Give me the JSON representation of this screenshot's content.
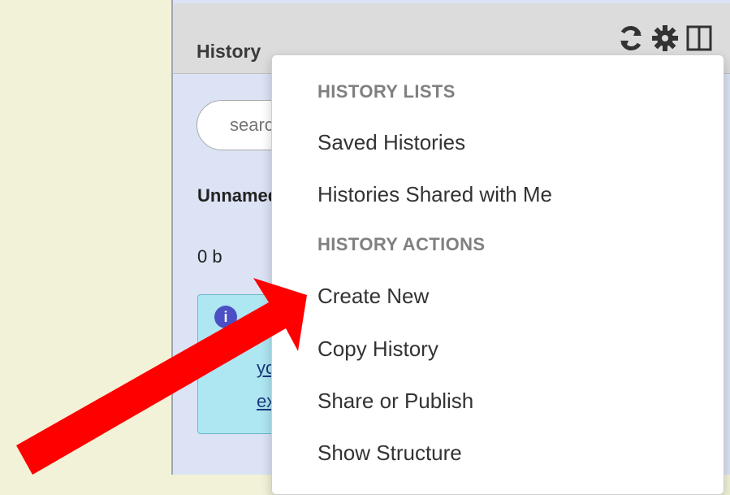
{
  "history_panel": {
    "title": "History",
    "search_placeholder": "search",
    "history_name": "Unnamed history",
    "history_size": "0 b",
    "info_link_line1": "you",
    "info_link_line2": "ex"
  },
  "header_icons": [
    "refresh-icon",
    "gear-icon",
    "columns-icon"
  ],
  "dropdown": {
    "header_lists": "HISTORY LISTS",
    "item_saved": "Saved Histories",
    "item_shared": "Histories Shared with Me",
    "header_actions": "HISTORY ACTIONS",
    "item_create": "Create New",
    "item_copy": "Copy History",
    "item_share": "Share or Publish",
    "item_structure": "Show Structure"
  },
  "colors": {
    "arrow": "#ff0000",
    "panel_bg": "#dbe3f5",
    "page_bg": "#f2f2d8",
    "info_bg": "#aee6f2"
  }
}
